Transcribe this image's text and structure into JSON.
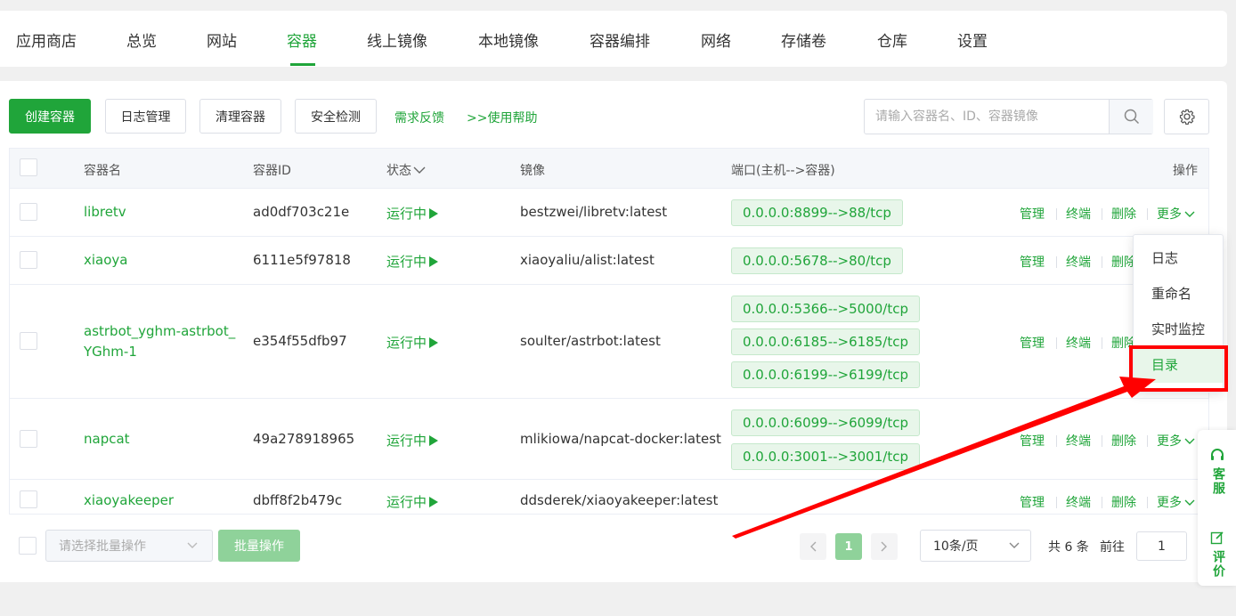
{
  "nav": {
    "tabs": [
      {
        "label": "应用商店"
      },
      {
        "label": "总览"
      },
      {
        "label": "网站"
      },
      {
        "label": "容器"
      },
      {
        "label": "线上镜像"
      },
      {
        "label": "本地镜像"
      },
      {
        "label": "容器编排"
      },
      {
        "label": "网络"
      },
      {
        "label": "存储卷"
      },
      {
        "label": "仓库"
      },
      {
        "label": "设置"
      }
    ],
    "active": "容器"
  },
  "toolbar": {
    "create_label": "创建容器",
    "log_label": "日志管理",
    "clean_label": "清理容器",
    "security_label": "安全检测",
    "feedback_link": "需求反馈",
    "help_link": ">>使用帮助",
    "search_placeholder": "请输入容器名、ID、容器镜像"
  },
  "table": {
    "headers": {
      "name": "容器名",
      "id": "容器ID",
      "status": "状态",
      "image": "镜像",
      "ports": "端口(主机-->容器)",
      "ops": "操作"
    },
    "actions": {
      "manage": "管理",
      "terminal": "终端",
      "delete": "删除",
      "more": "更多"
    },
    "rows": [
      {
        "name_line1": "libretv",
        "name_line2": "",
        "id": "ad0df703c21e",
        "status": "运行中",
        "image": "bestzwei/libretv:latest",
        "ports": [
          "0.0.0.0:8899-->88/tcp"
        ]
      },
      {
        "name_line1": "xiaoya",
        "name_line2": "",
        "id": "6111e5f97818",
        "status": "运行中",
        "image": "xiaoyaliu/alist:latest",
        "ports": [
          "0.0.0.0:5678-->80/tcp"
        ]
      },
      {
        "name_line1": "astrbot_yghm-astrbot_",
        "name_line2": "YGhm-1",
        "id": "e354f55dfb97",
        "status": "运行中",
        "image": "soulter/astrbot:latest",
        "ports": [
          "0.0.0.0:5366-->5000/tcp",
          "0.0.0.0:6185-->6185/tcp",
          "0.0.0.0:6199-->6199/tcp"
        ]
      },
      {
        "name_line1": "napcat",
        "name_line2": "",
        "id": "49a278918965",
        "status": "运行中",
        "image": "mlikiowa/napcat-docker:latest",
        "ports": [
          "0.0.0.0:6099-->6099/tcp",
          "0.0.0.0:3001-->3001/tcp"
        ]
      },
      {
        "name_line1": "xiaoyakeeper",
        "name_line2": "",
        "id": "dbff8f2b479c",
        "status": "运行中",
        "image": "ddsderek/xiaoyakeeper:latest",
        "ports": []
      }
    ]
  },
  "more_menu": {
    "items": [
      "日志",
      "重命名",
      "实时监控",
      "目录"
    ],
    "highlighted": "目录"
  },
  "footer": {
    "batch_placeholder": "请选择批量操作",
    "batch_button": "批量操作",
    "current_page": "1",
    "page_size": "10条/页",
    "total": "共 6 条",
    "goto_label": "前往",
    "goto_value": "1"
  },
  "float_bar": {
    "service": "客服",
    "review": "评价"
  },
  "colors": {
    "accent": "#20a53a",
    "annotation": "#ff0000"
  }
}
